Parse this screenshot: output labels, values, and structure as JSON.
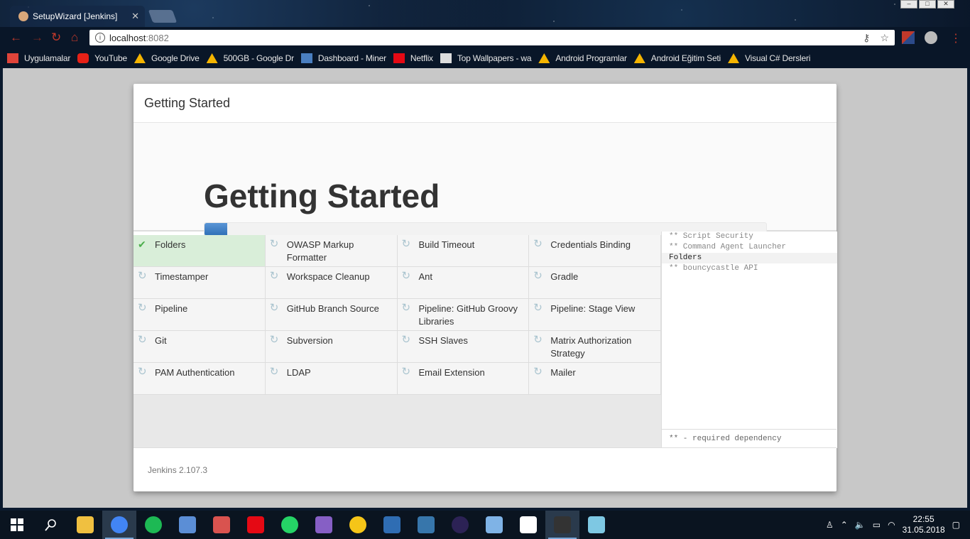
{
  "browser": {
    "tab_title": "SetupWizard [Jenkins]",
    "url_host": "localhost",
    "url_port": ":8082"
  },
  "bookmarks": [
    {
      "label": "Uygulamalar",
      "icon": "apps-grid-icon",
      "color": "#e0443a"
    },
    {
      "label": "YouTube",
      "icon": "youtube-icon",
      "color": "#e62117"
    },
    {
      "label": "Google Drive",
      "icon": "google-drive-icon",
      "color": "#f4b400"
    },
    {
      "label": "500GB - Google Dr",
      "icon": "google-drive-icon",
      "color": "#f4b400"
    },
    {
      "label": "Dashboard - Miner",
      "icon": "dashboard-icon",
      "color": "#4a7fc1"
    },
    {
      "label": "Netflix",
      "icon": "netflix-icon",
      "color": "#e50914"
    },
    {
      "label": "Top Wallpapers - wa",
      "icon": "wallpaper-icon",
      "color": "#dddddd"
    },
    {
      "label": "Android Programlar",
      "icon": "google-drive-icon",
      "color": "#f4b400"
    },
    {
      "label": "Android Eğitim Seti",
      "icon": "google-drive-icon",
      "color": "#f4b400"
    },
    {
      "label": "Visual C# Dersleri",
      "icon": "google-drive-icon",
      "color": "#f4b400"
    }
  ],
  "dialog": {
    "header": "Getting Started",
    "hero_title": "Getting Started",
    "progress": 0.04,
    "footer": "Jenkins 2.107.3"
  },
  "plugins": [
    [
      {
        "name": "Folders",
        "status": "done"
      },
      {
        "name": "OWASP Markup Formatter",
        "status": "pending"
      },
      {
        "name": "Build Timeout",
        "status": "pending"
      },
      {
        "name": "Credentials Binding",
        "status": "pending"
      }
    ],
    [
      {
        "name": "Timestamper",
        "status": "pending"
      },
      {
        "name": "Workspace Cleanup",
        "status": "pending"
      },
      {
        "name": "Ant",
        "status": "pending"
      },
      {
        "name": "Gradle",
        "status": "pending"
      }
    ],
    [
      {
        "name": "Pipeline",
        "status": "pending"
      },
      {
        "name": "GitHub Branch Source",
        "status": "pending"
      },
      {
        "name": "Pipeline: GitHub Groovy Libraries",
        "status": "pending"
      },
      {
        "name": "Pipeline: Stage View",
        "status": "pending"
      }
    ],
    [
      {
        "name": "Git",
        "status": "pending"
      },
      {
        "name": "Subversion",
        "status": "pending"
      },
      {
        "name": "SSH Slaves",
        "status": "pending"
      },
      {
        "name": "Matrix Authorization Strategy",
        "status": "pending"
      }
    ],
    [
      {
        "name": "PAM Authentication",
        "status": "pending"
      },
      {
        "name": "LDAP",
        "status": "pending"
      },
      {
        "name": "Email Extension",
        "status": "pending"
      },
      {
        "name": "Mailer",
        "status": "pending"
      }
    ]
  ],
  "log": [
    {
      "text": "** Script Security",
      "current": false
    },
    {
      "text": "** Command Agent Launcher",
      "current": false
    },
    {
      "text": "Folders",
      "current": true
    },
    {
      "text": "** bouncycastle API",
      "current": false
    }
  ],
  "log_footer": "** - required dependency",
  "taskbar": {
    "apps": [
      {
        "name": "file-explorer-icon",
        "color": "#f0c040",
        "active": false
      },
      {
        "name": "chrome-icon",
        "color": "#4285f4",
        "active": true
      },
      {
        "name": "spotify-icon",
        "color": "#1db954",
        "active": false
      },
      {
        "name": "network-computer-icon",
        "color": "#5b8ed6",
        "active": false
      },
      {
        "name": "snipping-tool-icon",
        "color": "#d9534f",
        "active": false
      },
      {
        "name": "netflix-icon",
        "color": "#e50914",
        "active": false
      },
      {
        "name": "whatsapp-icon",
        "color": "#25d366",
        "active": false
      },
      {
        "name": "visual-studio-icon",
        "color": "#865fc5",
        "active": false
      },
      {
        "name": "smiley-app-icon",
        "color": "#f5c518",
        "active": false
      },
      {
        "name": "devcpp-icon",
        "color": "#2f6db3",
        "active": false
      },
      {
        "name": "python-icon",
        "color": "#3776ab",
        "active": false
      },
      {
        "name": "eclipse-icon",
        "color": "#2c2255",
        "active": false
      },
      {
        "name": "virtualbox-icon",
        "color": "#7fb3e6",
        "active": false
      },
      {
        "name": "settings-gear-icon",
        "color": "#ffffff",
        "active": false
      },
      {
        "name": "command-prompt-icon",
        "color": "#333333",
        "active": true
      },
      {
        "name": "notepad-icon",
        "color": "#7ec8e3",
        "active": false
      }
    ],
    "time": "22:55",
    "date": "31.05.2018"
  }
}
